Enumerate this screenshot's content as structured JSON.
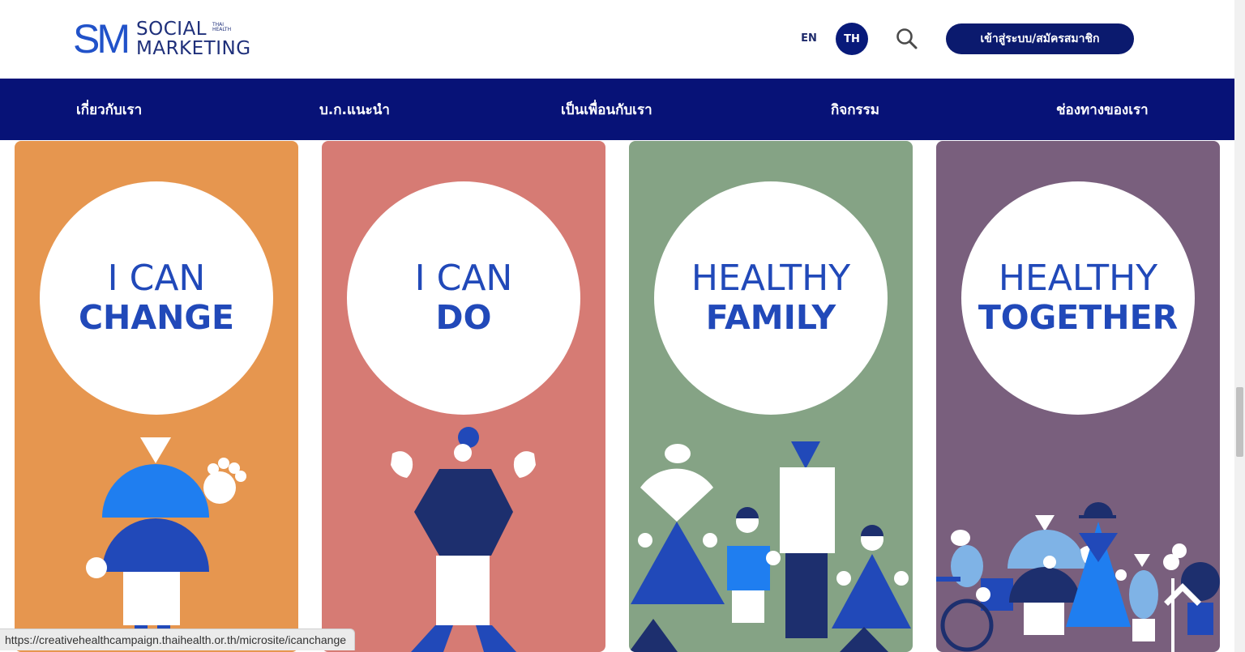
{
  "header": {
    "logo_mark": "SM",
    "logo_line1": "SOCIAL",
    "logo_line2": "MARKETING",
    "logo_small1": "THAI",
    "logo_small2": "HEALTH",
    "lang_en": "EN",
    "lang_th": "TH",
    "login_label": "เข้าสู่ระบบ/สมัครสมาชิก"
  },
  "nav": {
    "items": [
      {
        "label": "เกี่ยวกับเรา"
      },
      {
        "label": "บ.ก.แนะนำ"
      },
      {
        "label": "เป็นเพื่อนกับเรา"
      },
      {
        "label": "กิจกรรม"
      },
      {
        "label": "ช่องทางของเรา"
      }
    ]
  },
  "cards": [
    {
      "line1": "I CAN",
      "line2": "CHANGE",
      "bg": "#e6964f"
    },
    {
      "line1": "I CAN",
      "line2": "DO",
      "bg": "#d67b74"
    },
    {
      "line1": "HEALTHY",
      "line2": "FAMILY",
      "bg": "#85a385"
    },
    {
      "line1": "HEALTHY",
      "line2": "TOGETHER",
      "bg": "#795f7d"
    }
  ],
  "status": {
    "url": "https://creativehealthcampaign.thaihealth.or.th/microsite/icanchange"
  },
  "icons": {
    "search": "search-icon",
    "to_top": "chevron-up-icon"
  },
  "colors": {
    "nav_bg": "#071277",
    "accent": "#2149b9",
    "login_bg": "#0b1a6e"
  }
}
